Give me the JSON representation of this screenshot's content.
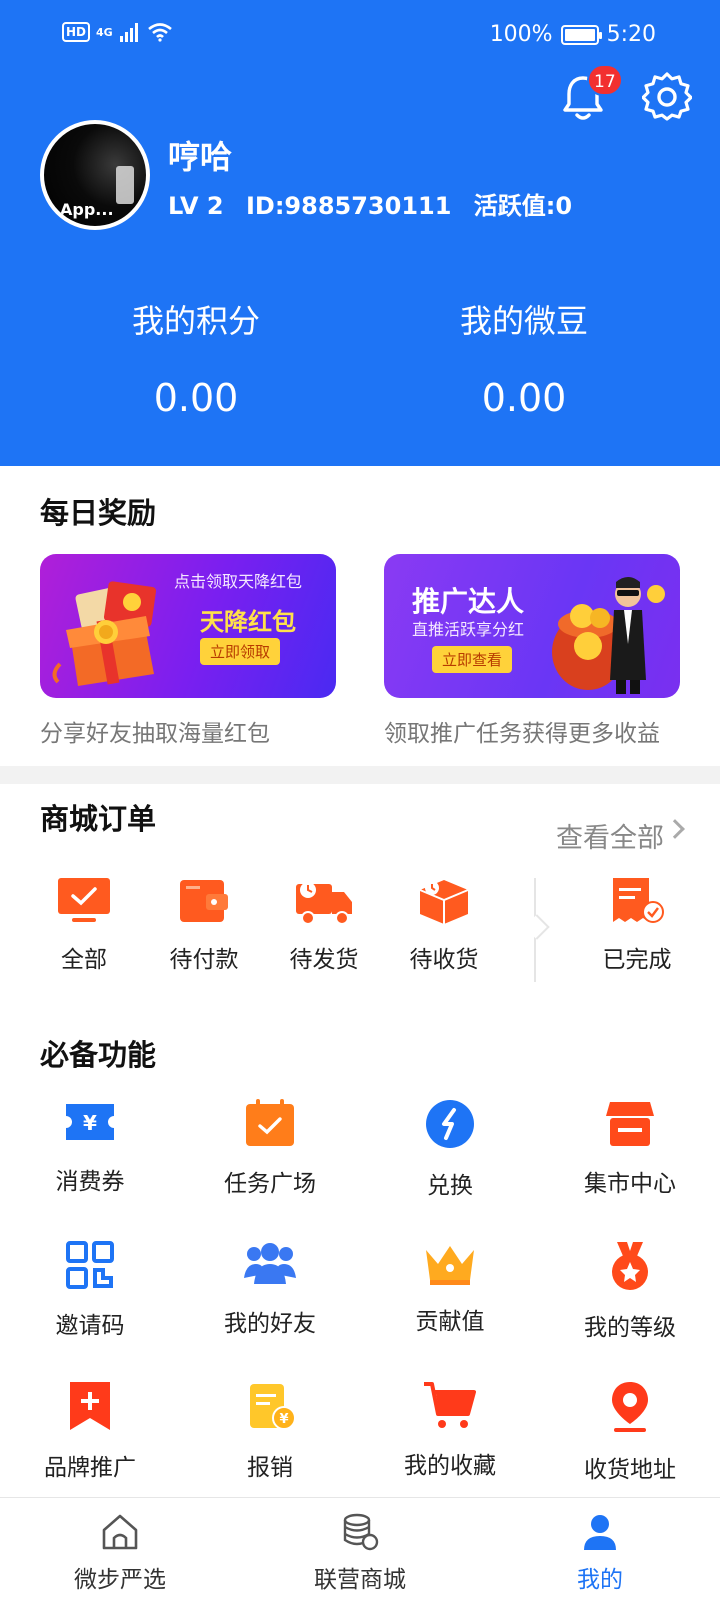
{
  "status_bar": {
    "hd": "HD",
    "network": "4G",
    "battery": "100%",
    "battery_level": 1.0,
    "time": "5:20"
  },
  "header": {
    "notification_count": "17",
    "avatar_text": "App...",
    "username": "哼哈",
    "level": "LV 2",
    "user_id": "ID:9885730111",
    "activity": "活跃值:0",
    "stats": [
      {
        "label": "我的积分",
        "value": "0.00"
      },
      {
        "label": "我的微豆",
        "value": "0.00"
      }
    ]
  },
  "daily_reward": {
    "title": "每日奖励",
    "banners": [
      {
        "top_text": "点击领取天降红包",
        "headline": "天降红包",
        "button": "立即领取",
        "caption": "分享好友抽取海量红包"
      },
      {
        "headline": "推广达人",
        "sub_text": "直推活跃享分红",
        "button": "立即查看",
        "caption": "领取推广任务获得更多收益"
      }
    ]
  },
  "orders": {
    "title": "商城订单",
    "view_all": "查看全部",
    "items": [
      {
        "label": "全部",
        "icon": "monitor-icon"
      },
      {
        "label": "待付款",
        "icon": "wallet-icon"
      },
      {
        "label": "待发货",
        "icon": "truck-icon"
      },
      {
        "label": "待收货",
        "icon": "package-icon"
      },
      {
        "label": "已完成",
        "icon": "receipt-check-icon"
      }
    ]
  },
  "functions": {
    "title": "必备功能",
    "items": [
      {
        "label": "消费券",
        "icon": "coupon-icon"
      },
      {
        "label": "任务广场",
        "icon": "calendar-check-icon"
      },
      {
        "label": "兑换",
        "icon": "exchange-icon"
      },
      {
        "label": "集市中心",
        "icon": "store-icon"
      },
      {
        "label": "邀请码",
        "icon": "qr-code-icon"
      },
      {
        "label": "我的好友",
        "icon": "friends-icon"
      },
      {
        "label": "贡献值",
        "icon": "crown-icon"
      },
      {
        "label": "我的等级",
        "icon": "medal-icon"
      },
      {
        "label": "品牌推广",
        "icon": "bookmark-plus-icon"
      },
      {
        "label": "报销",
        "icon": "reimburse-icon"
      },
      {
        "label": "我的收藏",
        "icon": "cart-icon"
      },
      {
        "label": "收货地址",
        "icon": "location-pin-icon"
      }
    ]
  },
  "bottom_nav": {
    "items": [
      {
        "label": "微步严选",
        "icon": "home-icon"
      },
      {
        "label": "联营商城",
        "icon": "coins-stack-icon"
      },
      {
        "label": "我的",
        "icon": "user-icon",
        "active": true
      }
    ]
  },
  "colors": {
    "primary": "#1e74f5",
    "orange": "#ff5a1f",
    "badge_red": "#f23030"
  }
}
